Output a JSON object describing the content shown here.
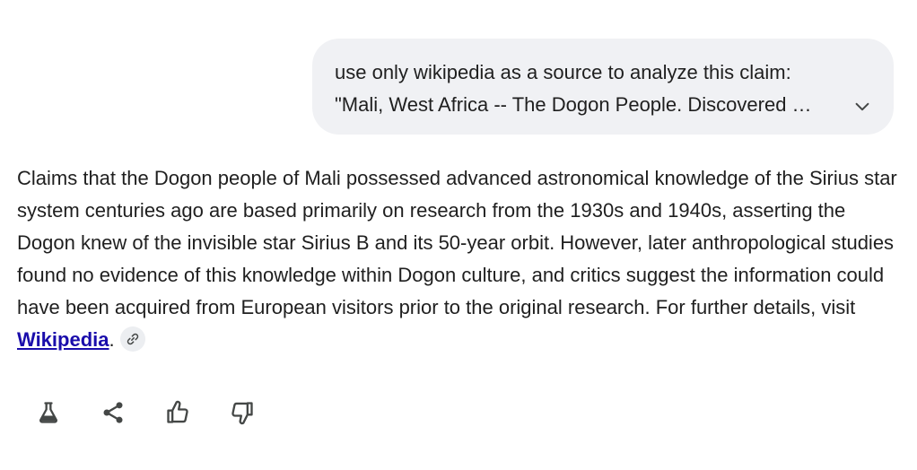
{
  "user_message": {
    "line1": "use only wikipedia as a source to analyze this claim:",
    "line2": "\"Mali, West Africa -- The Dogon People. Discovered …"
  },
  "response": {
    "text": "Claims that the Dogon people of Mali possessed advanced astronomical knowledge of the Sirius star system centuries ago are based primarily on research from the 1930s and 1940s, asserting the Dogon knew of the invisible star Sirius B and its 50-year orbit. However, later anthropological studies found no evidence of this knowledge within Dogon culture, and critics suggest the information could have been acquired from European visitors prior to the original research. For further details, visit ",
    "link_text": "Wikipedia",
    "trailing": "."
  },
  "icons": {
    "expand": "chevron-down-icon",
    "link": "link-icon",
    "actions": [
      "flask-icon",
      "share-icon",
      "thumbs-up-icon",
      "thumbs-down-icon"
    ]
  },
  "colors": {
    "bubble_bg": "#f0f1f4",
    "link": "#1a0dab",
    "text": "#1f1f1f",
    "icon": "#444746"
  }
}
